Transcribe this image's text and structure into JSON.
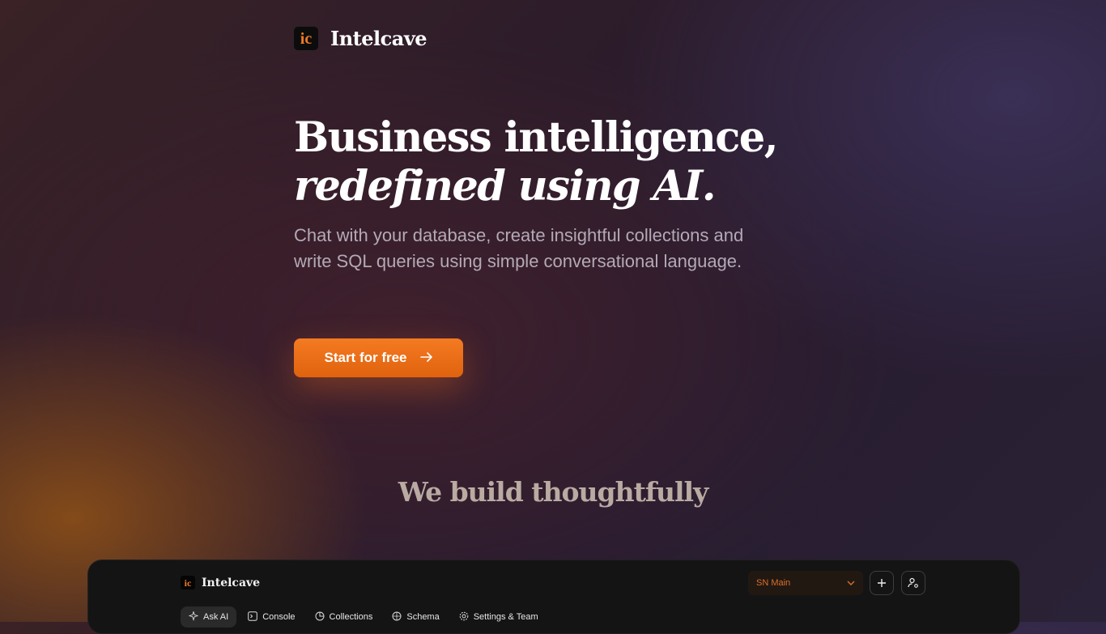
{
  "header": {
    "logo_mark": "ic",
    "brand": "Intelcave"
  },
  "hero": {
    "title_line1": "Business intelligence,",
    "title_line2": "redefined using AI.",
    "subtitle": "Chat with your database, create insightful collections and write SQL queries using simple conversational language.",
    "cta_label": "Start for free",
    "cta_icon": "arrow-right-icon"
  },
  "section": {
    "title": "We build thoughtfully"
  },
  "app_preview": {
    "logo_mark": "ic",
    "brand": "Intelcave",
    "workspace": "SN Main",
    "tabs": [
      {
        "label": "Ask AI",
        "icon": "sparkle-icon",
        "active": true
      },
      {
        "label": "Console",
        "icon": "terminal-icon",
        "active": false
      },
      {
        "label": "Collections",
        "icon": "pie-chart-icon",
        "active": false
      },
      {
        "label": "Schema",
        "icon": "globe-icon",
        "active": false
      },
      {
        "label": "Settings & Team",
        "icon": "gear-icon",
        "active": false
      }
    ]
  },
  "colors": {
    "accent": "#f07a22",
    "background": "#2d1c2a",
    "app_frame": "#151414"
  }
}
